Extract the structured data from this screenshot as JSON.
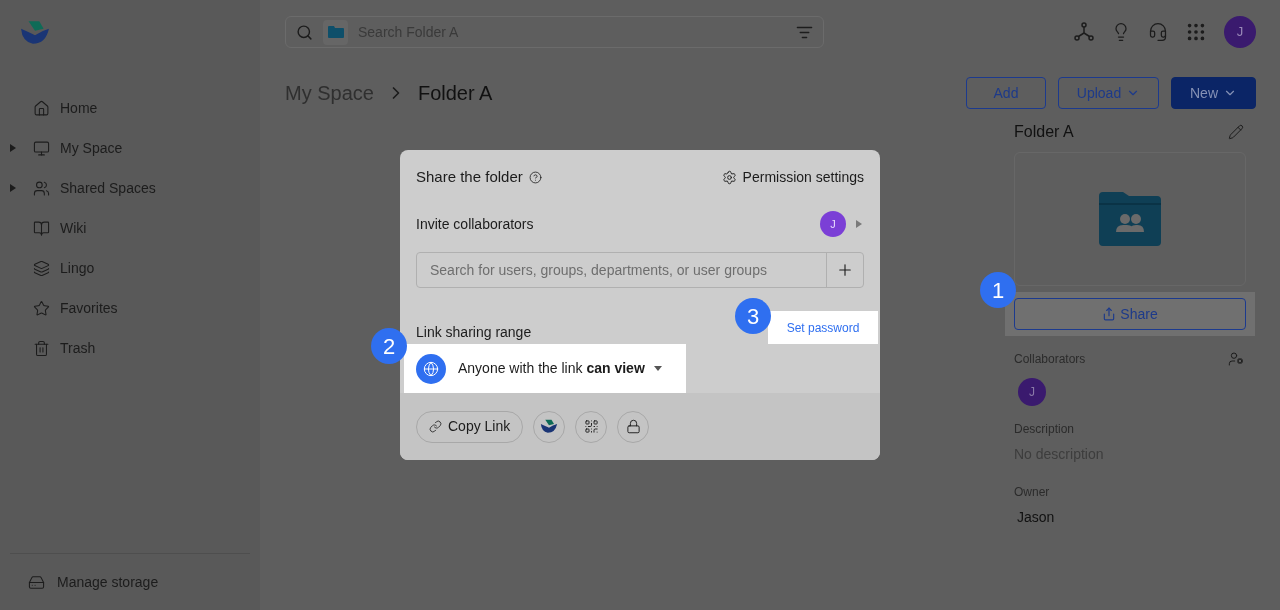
{
  "header": {
    "search": {
      "placeholder": "Search Folder A"
    },
    "avatar": "J"
  },
  "sidebar": {
    "items": [
      {
        "label": "Home",
        "has_children": false
      },
      {
        "label": "My Space",
        "has_children": true
      },
      {
        "label": "Shared Spaces",
        "has_children": true
      },
      {
        "label": "Wiki",
        "has_children": false
      },
      {
        "label": "Lingo",
        "has_children": false
      },
      {
        "label": "Favorites",
        "has_children": false
      },
      {
        "label": "Trash",
        "has_children": false
      }
    ],
    "footer": "Manage storage"
  },
  "breadcrumb": [
    "My Space",
    "Folder A"
  ],
  "actions": [
    {
      "label": "Add",
      "kind": "outline",
      "menu": false
    },
    {
      "label": "Upload",
      "kind": "outline",
      "menu": true
    },
    {
      "label": "New",
      "kind": "primary",
      "menu": true
    }
  ],
  "details": {
    "title": "Folder A",
    "share_button": "Share",
    "collaborators_label": "Collaborators",
    "collaborators": [
      "J"
    ],
    "description_label": "Description",
    "description": "No description",
    "owner_label": "Owner",
    "owner": "Jason"
  },
  "dialog": {
    "title": "Share the folder",
    "permission_settings": "Permission settings",
    "invite_label": "Invite collaborators",
    "invite_avatar": "J",
    "search": {
      "placeholder": "Search for users, groups, departments, or user groups"
    },
    "link_range_label": "Link sharing range",
    "set_password": "Set password",
    "link_option": "Anyone with the link **can view**",
    "copy_link": "Copy Link"
  },
  "callouts": [
    "1",
    "2",
    "3"
  ]
}
